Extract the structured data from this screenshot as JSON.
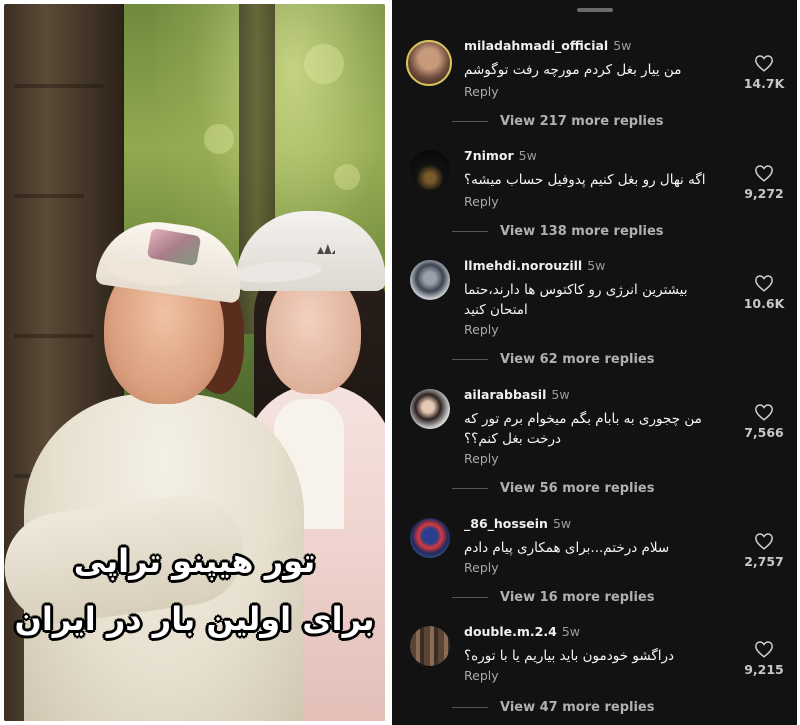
{
  "video": {
    "caption_line1": "تور هیپنو تراپی",
    "caption_line2": "برای اولین بار در ایران"
  },
  "comments": [
    {
      "username": "miladahmadi_official",
      "time": "5w",
      "text": "من ییار بغل کردم مورچه رفت توگوشم",
      "reply_label": "Reply",
      "likes": "14.7K",
      "view_more": "View 217 more replies",
      "avatar_icon": "profile-photo-ring-avatar"
    },
    {
      "username": "7nimor",
      "time": "5w",
      "text": "اگه نهال رو بغل کنیم پدوفیل حساب میشه؟",
      "reply_label": "Reply",
      "likes": "9,272",
      "view_more": "View 138 more replies",
      "avatar_icon": "dark-profile-avatar"
    },
    {
      "username": "llmehdi.norouzill",
      "time": "5w",
      "text": "بیشترین انرژی رو کاکتوس ها دارند،حتما امتحان کنید",
      "reply_label": "Reply",
      "likes": "10.6K",
      "view_more": "View 62 more replies",
      "avatar_icon": "person-standing-avatar"
    },
    {
      "username": "ailarabbasil",
      "time": "5w",
      "text": "من چجوری به بابام بگم میخوام برم تور که درخت بغل کنم؟؟",
      "reply_label": "Reply",
      "likes": "7,566",
      "view_more": "View 56 more replies",
      "avatar_icon": "woman-profile-avatar"
    },
    {
      "username": "_86_hossein",
      "time": "5w",
      "text": "سلام درختم...برای همکاری پیام دادم",
      "reply_label": "Reply",
      "likes": "2,757",
      "view_more": "View 16 more replies",
      "avatar_icon": "helmet-profile-avatar"
    },
    {
      "username": "double.m.2.4",
      "time": "5w",
      "text": "دراگشو خودمون باید بیاریم یا با توره؟",
      "reply_label": "Reply",
      "likes": "9,215",
      "view_more": "View 47 more replies",
      "avatar_icon": "group-profile-avatar"
    }
  ],
  "colors": {
    "panel_bg": "#121212",
    "text": "#ffffff",
    "muted": "#a8a8a8"
  }
}
